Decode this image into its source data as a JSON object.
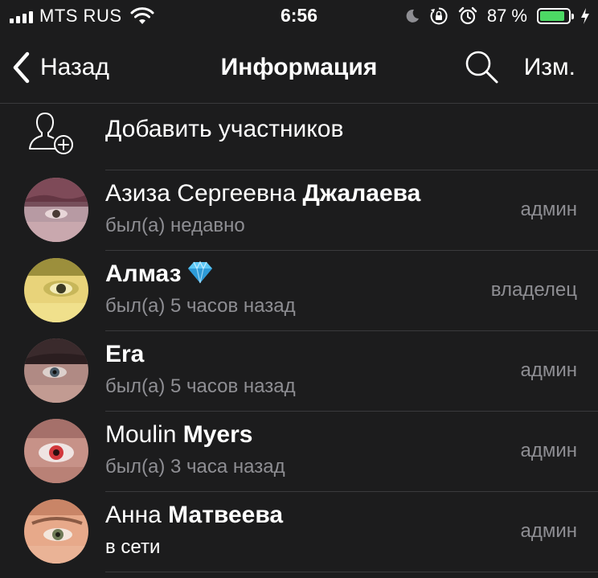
{
  "status_bar": {
    "carrier": "MTS RUS",
    "time": "6:56",
    "battery_percent": "87 %",
    "battery_level": 0.87,
    "icons": [
      "signal-icon",
      "wifi-icon",
      "moon-icon",
      "rotation-lock-icon",
      "alarm-icon",
      "battery-icon",
      "charging-bolt-icon"
    ]
  },
  "nav": {
    "back_label": "Назад",
    "title": "Информация",
    "edit_label": "Изм.",
    "search_icon": "search-icon"
  },
  "add_members": {
    "label": "Добавить участников",
    "icon": "add-user-icon"
  },
  "members": [
    {
      "first": "Азиза Сергеевна ",
      "last": "Джалаева",
      "status": "был(а) недавно",
      "role": "админ",
      "online": false
    },
    {
      "first": "",
      "last": "Алмаз",
      "status": "был(а) 5 часов назад",
      "role": "владелец",
      "online": false,
      "badge": "diamond-emoji"
    },
    {
      "first": "",
      "last": "Era",
      "status": "был(а) 5 часов назад",
      "role": "админ",
      "online": false
    },
    {
      "first": "Moulin ",
      "last": "Myers",
      "status": "был(а) 3 часа назад",
      "role": "админ",
      "online": false
    },
    {
      "first": "Анна ",
      "last": "Матвеева",
      "status": "в сети",
      "role": "админ",
      "online": true
    }
  ],
  "colors": {
    "background": "#1c1c1d",
    "secondary_text": "#8e8e93",
    "separator": "#3a3a3c",
    "battery_fill": "#4cd964"
  }
}
